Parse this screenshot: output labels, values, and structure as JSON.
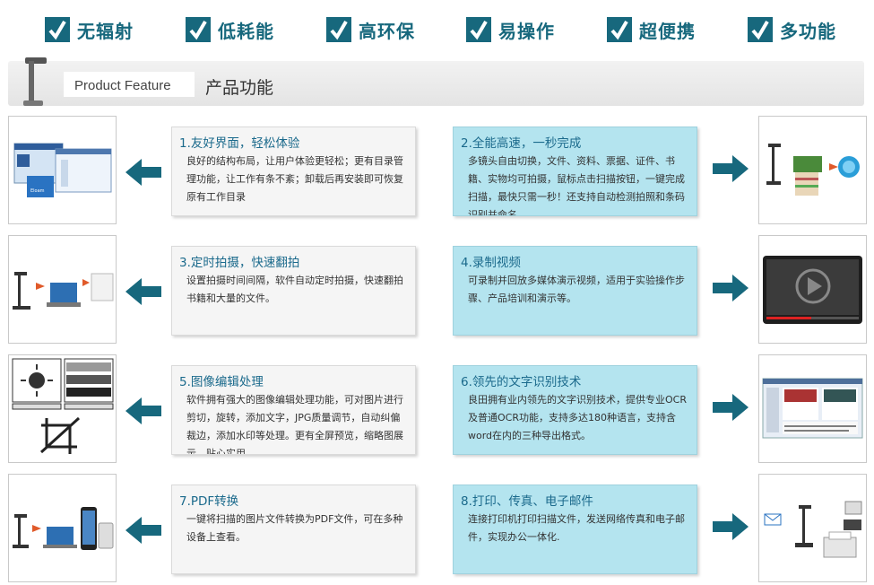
{
  "features": [
    "无辐射",
    "低耗能",
    "高环保",
    "易操作",
    "超便携",
    "多功能"
  ],
  "header": {
    "en": "Product Feature",
    "cn": "产品功能"
  },
  "cards": [
    {
      "title": "1.友好界面，轻松体验",
      "desc": "良好的结构布局，让用户体验更轻松；更有目录管理功能，让工作有条不紊；卸载后再安装即可恢复原有工作目录"
    },
    {
      "title": "2.全能高速，一秒完成",
      "desc": "多镜头自由切换，文件、资料、票据、证件、书籍、实物均可拍摄，鼠标点击扫描按钮，一键完成扫描，最快只需一秒！还支持自动检测拍照和条码识别并命名"
    },
    {
      "title": "3.定时拍摄，快速翻拍",
      "desc": "设置拍摄时间间隔，软件自动定时拍摄，快速翻拍书籍和大量的文件。"
    },
    {
      "title": "4.录制视频",
      "desc": "可录制并回放多媒体演示视频，适用于实验操作步骤、产品培训和演示等。"
    },
    {
      "title": "5.图像编辑处理",
      "desc": "软件拥有强大的图像编辑处理功能，可对图片进行剪切，旋转，添加文字，JPG质量调节，自动纠偏裁边，添加水印等处理。更有全屏预览，缩略图展示，贴心实用"
    },
    {
      "title": "6.领先的文字识别技术",
      "desc": "良田拥有业内领先的文字识别技术，提供专业OCR及普通OCR功能，支持多达180种语言，支持含word在内的三种导出格式。"
    },
    {
      "title": "7.PDF转换",
      "desc": "一键将扫描的图片文件转换为PDF文件，可在多种设备上查看。"
    },
    {
      "title": "8.打印、传真、电子邮件",
      "desc": "连接打印机打印扫描文件，发送网络传真和电子邮件，实现办公一体化."
    }
  ],
  "images": {
    "left": [
      "software-ui-screenshot-image",
      "scanner-laptop-printer-image",
      "image-editing-icons-image",
      "scanner-pdf-devices-image"
    ],
    "right": [
      "scanner-documents-image",
      "video-player-image",
      "ocr-software-screenshot-image",
      "scanner-print-fax-email-image"
    ]
  },
  "colors": {
    "accent": "#17687d",
    "cardBlue": "#b4e4ef",
    "cardGrey": "#f5f5f5",
    "titleBlue": "#1b6a8c"
  }
}
